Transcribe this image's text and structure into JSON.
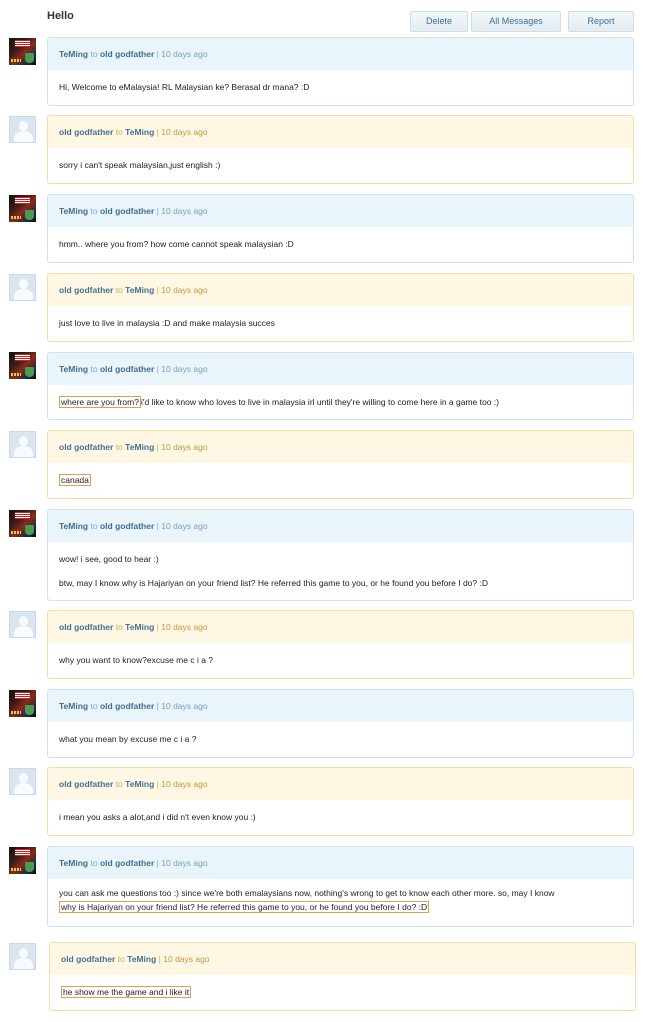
{
  "page": {
    "title": "Hello"
  },
  "toolbar": {
    "delete_label": "Delete",
    "all_messages_label": "All Messages",
    "report_label": "Report"
  },
  "messages": [
    {
      "from": "TeMing",
      "to_word": "to",
      "to": "old godfather",
      "sep": "|",
      "time": "10 days ago",
      "lines": [
        {
          "pre": "Hi, Welcome to eMalaysia! RL Malaysian ke? Berasal dr mana? :D",
          "hl": "",
          "post": ""
        }
      ]
    },
    {
      "from": "old godfather",
      "to_word": "to",
      "to": "TeMing",
      "sep": "|",
      "time": "10 days ago",
      "lines": [
        {
          "pre": "sorry i can't speak malaysian,just english :)",
          "hl": "",
          "post": ""
        }
      ]
    },
    {
      "from": "TeMing",
      "to_word": "to",
      "to": "old godfather",
      "sep": "|",
      "time": "10 days ago",
      "lines": [
        {
          "pre": "hmm.. where you from? how come cannot speak malaysian :D",
          "hl": "",
          "post": ""
        }
      ]
    },
    {
      "from": "old godfather",
      "to_word": "to",
      "to": "TeMing",
      "sep": "|",
      "time": "10 days ago",
      "lines": [
        {
          "pre": "just love to live in malaysia :D and make malaysia succes",
          "hl": "",
          "post": ""
        }
      ]
    },
    {
      "from": "TeMing",
      "to_word": "to",
      "to": "old godfather",
      "sep": "|",
      "time": "10 days ago",
      "lines": [
        {
          "pre": "",
          "hl": "where are you from?",
          "post": "i'd like to know who loves to live in malaysia irl until they're willing to come here in a game too :)"
        }
      ]
    },
    {
      "from": "old godfather",
      "to_word": "to",
      "to": "TeMing",
      "sep": "|",
      "time": "10 days ago",
      "lines": [
        {
          "pre": "",
          "hl": "canada",
          "post": ""
        }
      ]
    },
    {
      "from": "TeMing",
      "to_word": "to",
      "to": "old godfather",
      "sep": "|",
      "time": "10 days ago",
      "lines": [
        {
          "pre": "wow! i see, good to hear :)",
          "hl": "",
          "post": ""
        },
        {
          "pre": "btw, may I know why is Hajariyan on your friend list? He referred this game to you, or he found you before I do? :D",
          "hl": "",
          "post": ""
        }
      ]
    },
    {
      "from": "old godfather",
      "to_word": "to",
      "to": "TeMing",
      "sep": "|",
      "time": "10 days ago",
      "lines": [
        {
          "pre": "why you want to know?excuse me c i a ?",
          "hl": "",
          "post": ""
        }
      ]
    },
    {
      "from": "TeMing",
      "to_word": "to",
      "to": "old godfather",
      "sep": "|",
      "time": "10 days ago",
      "lines": [
        {
          "pre": "what you mean by excuse me c i a ?",
          "hl": "",
          "post": ""
        }
      ]
    },
    {
      "from": "old godfather",
      "to_word": "to",
      "to": "TeMing",
      "sep": "|",
      "time": "10 days ago",
      "lines": [
        {
          "pre": "i mean you asks a alot,and i did n't even know you :)",
          "hl": "",
          "post": ""
        }
      ]
    },
    {
      "from": "TeMing",
      "to_word": "to",
      "to": "old godfather",
      "sep": "|",
      "time": "10 days ago",
      "lines": [
        {
          "pre": "you can ask me questions too :) since we're both emalaysians now, nothing's wrong to get to know each other more. so, may I know",
          "hl": "",
          "post": ""
        },
        {
          "pre": "",
          "hl": "why is Hajariyan on your friend list? He referred this game to you, or he found you before I do? :D",
          "post": ""
        }
      ]
    },
    {
      "from": "old godfather",
      "to_word": "to",
      "to": "TeMing",
      "sep": "|",
      "time": "10 days ago",
      "lines": [
        {
          "pre": "",
          "hl": "he show me the game and i like it",
          "post": ""
        }
      ]
    }
  ]
}
